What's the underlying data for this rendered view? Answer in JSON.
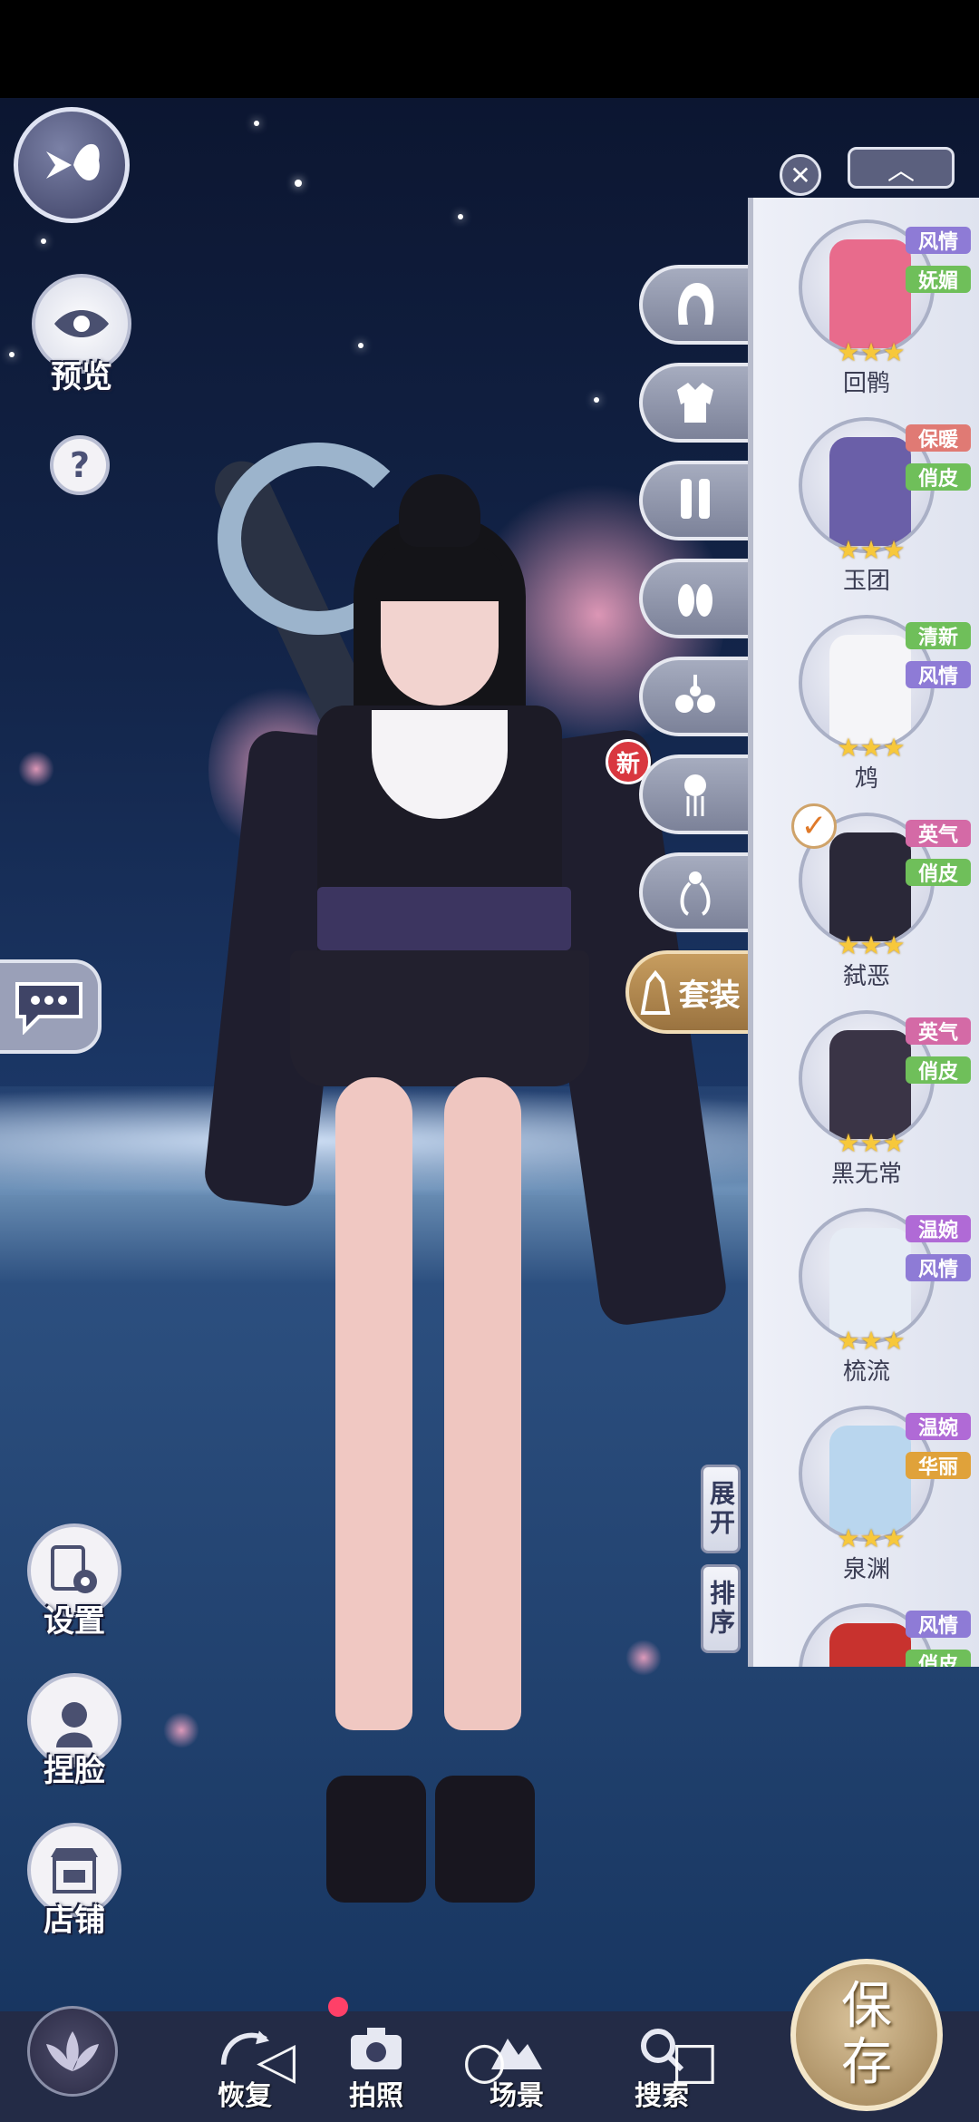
{
  "left_controls": {
    "preview_label": "预览",
    "help_label": "?",
    "settings_label": "设置",
    "face_label": "捏脸",
    "shop_label": "店铺"
  },
  "category_tabs": {
    "new_badge": "新",
    "set_label": "套装"
  },
  "panel": {
    "close_label": "✕",
    "collapse_label": "︿",
    "expand_label": "展开",
    "sort_label": "排序",
    "outfits": [
      {
        "name": "回鹘",
        "tags": [
          "风情",
          "妩媚"
        ],
        "tag_colors": [
          "#8e7bd6",
          "#6fbf5a"
        ],
        "stars": "★★★",
        "art_color": "#e86b8c",
        "selected": false
      },
      {
        "name": "玉团",
        "tags": [
          "保暖",
          "俏皮"
        ],
        "tag_colors": [
          "#e07a74",
          "#6fbf5a"
        ],
        "stars": "★★★",
        "art_color": "#6a5fa8",
        "selected": false
      },
      {
        "name": "鸩",
        "tags": [
          "清新",
          "风情"
        ],
        "tag_colors": [
          "#6fbf5a",
          "#8e7bd6"
        ],
        "stars": "★★★",
        "art_color": "#f5f5f8",
        "selected": false
      },
      {
        "name": "弑恶",
        "tags": [
          "英气",
          "俏皮"
        ],
        "tag_colors": [
          "#d46aa6",
          "#6fbf5a"
        ],
        "stars": "★★★",
        "art_color": "#2a2838",
        "selected": true,
        "check": "✓"
      },
      {
        "name": "黑无常",
        "tags": [
          "英气",
          "俏皮"
        ],
        "tag_colors": [
          "#d46aa6",
          "#6fbf5a"
        ],
        "stars": "★★★",
        "art_color": "#3a3446",
        "selected": false
      },
      {
        "name": "梳流",
        "tags": [
          "温婉",
          "风情"
        ],
        "tag_colors": [
          "#b06ad6",
          "#8e7bd6"
        ],
        "stars": "★★★",
        "art_color": "#e6ecf5",
        "selected": false
      },
      {
        "name": "泉渊",
        "tags": [
          "温婉",
          "华丽"
        ],
        "tag_colors": [
          "#b06ad6",
          "#e0a23a"
        ],
        "stars": "★★★",
        "art_color": "#b9d6ee",
        "selected": false
      },
      {
        "name": "",
        "tags": [
          "风情",
          "俏皮"
        ],
        "tag_colors": [
          "#8e7bd6",
          "#6fbf5a"
        ],
        "stars": "",
        "art_color": "#c8322e",
        "selected": false
      }
    ]
  },
  "bottom_bar": {
    "restore_label": "恢复",
    "photo_label": "拍照",
    "scene_label": "场景",
    "search_label": "搜索",
    "save_label_1": "保",
    "save_label_2": "存"
  },
  "system_nav": {
    "back_glyph": "◁",
    "home_glyph": "○",
    "recents_glyph": "□"
  }
}
